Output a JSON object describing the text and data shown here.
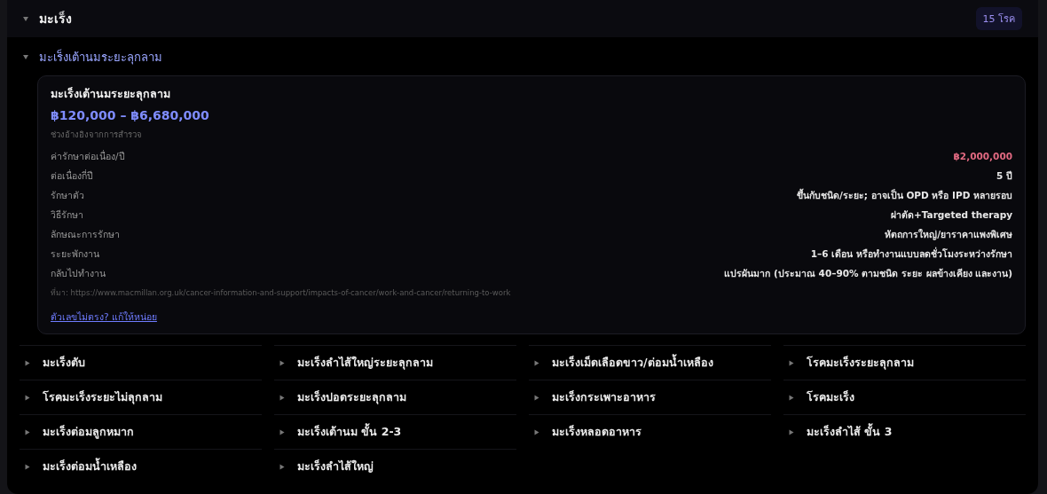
{
  "section": {
    "title": "มะเร็ง",
    "expanded": true,
    "count": "15 โรค",
    "subsection": {
      "title": "มะเร็งเต้านมระยะลุกลาม",
      "expanded": true,
      "card": {
        "title": "มะเร็งเต้านมระยะลุกลาม",
        "range": "฿120,000 – ฿6,680,000",
        "range_note": "ช่วงอ้างอิงจากการสำรวจ",
        "rows": [
          {
            "label": "ค่ารักษาต่อเนื่อง/ปี",
            "value": "฿2,000,000",
            "kind": "cost"
          },
          {
            "label": "ต่อเนื่องกี่ปี",
            "value": "5 ปี",
            "kind": "plain"
          },
          {
            "label": "รักษาตัว",
            "value": "ขึ้นกับชนิด/ระยะ; อาจเป็น OPD หรือ IPD หลายรอบ",
            "kind": "plain"
          },
          {
            "label": "วิธีรักษา",
            "value": "ผ่าตัด+Targeted therapy",
            "kind": "plain"
          },
          {
            "label": "ลักษณะการรักษา",
            "value": "หัตถการใหญ่/ยาราคาแพงพิเศษ",
            "kind": "plain"
          },
          {
            "label": "ระยะพักงาน",
            "value": "1–6 เดือน หรือทำงานแบบลดชั่วโมงระหว่างรักษา",
            "kind": "plain"
          },
          {
            "label": "กลับไปทำงาน",
            "value": "แปรผันมาก (ประมาณ 40–90% ตามชนิด ระยะ ผลข้างเคียง และงาน)",
            "kind": "plain"
          }
        ],
        "source": "ที่มา: https://www.macmillan.org.uk/cancer-information-and-support/impacts-of-cancer/work-and-cancer/returning-to-work",
        "report_link": "ตัวเลขไม่ตรง? แก้ให้หน่อย"
      }
    },
    "items": [
      {
        "title": "มะเร็งตับ",
        "expanded": false
      },
      {
        "title": "มะเร็งลำไส้ใหญ่ระยะลุกลาม",
        "expanded": false
      },
      {
        "title": "มะเร็งเม็ดเลือดขาว/ต่อมน้ำเหลือง",
        "expanded": false
      },
      {
        "title": "โรคมะเร็งระยะลุกลาม",
        "expanded": false
      },
      {
        "title": "โรคมะเร็งระยะไม่ลุกลาม",
        "expanded": false
      },
      {
        "title": "มะเร็งปอดระยะลุกลาม",
        "expanded": false
      },
      {
        "title": "มะเร็งกระเพาะอาหาร",
        "expanded": false
      },
      {
        "title": "โรคมะเร็ง",
        "expanded": false
      },
      {
        "title": "มะเร็งต่อมลูกหมาก",
        "expanded": false
      },
      {
        "title": "มะเร็งเต้านม ขั้น 2-3",
        "expanded": false
      },
      {
        "title": "มะเร็งหลอดอาหาร",
        "expanded": false
      },
      {
        "title": "มะเร็งลำไส้ ขั้น 3",
        "expanded": false
      },
      {
        "title": "มะเร็งต่อมน้ำเหลือง",
        "expanded": false
      },
      {
        "title": "มะเร็งลำไส้ใหญ่",
        "expanded": false
      }
    ]
  }
}
